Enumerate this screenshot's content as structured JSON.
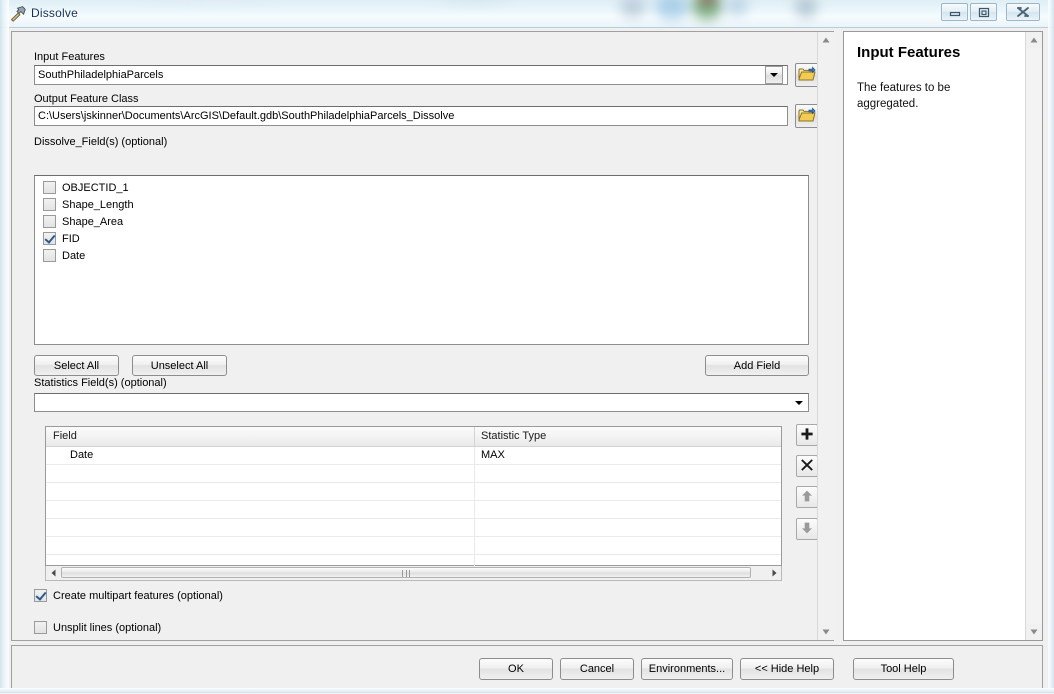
{
  "window": {
    "title": "Dissolve",
    "icon": "hammer-tool-icon",
    "controls": {
      "minimize": "minimize-icon",
      "maximize": "maximize-icon",
      "close": "close-icon"
    }
  },
  "form": {
    "input_features": {
      "label": "Input Features",
      "value": "SouthPhiladelphiaParcels",
      "browse_icon": "open-folder-icon",
      "dropdown_icon": "chevron-down-icon"
    },
    "output_feature_class": {
      "label": "Output Feature Class",
      "value": "C:\\Users\\jskinner\\Documents\\ArcGIS\\Default.gdb\\SouthPhiladelphiaParcels_Dissolve",
      "browse_icon": "open-folder-icon"
    },
    "dissolve_fields": {
      "label": "Dissolve_Field(s) (optional)",
      "items": [
        {
          "name": "OBJECTID_1",
          "checked": false
        },
        {
          "name": "Shape_Length",
          "checked": false
        },
        {
          "name": "Shape_Area",
          "checked": false
        },
        {
          "name": "FID",
          "checked": true
        },
        {
          "name": "Date",
          "checked": false
        }
      ]
    },
    "list_buttons": {
      "select_all": "Select All",
      "unselect_all": "Unselect All",
      "add_field": "Add Field"
    },
    "statistics_fields": {
      "label": "Statistics Field(s) (optional)",
      "value": "",
      "dropdown_icon": "chevron-down-icon"
    },
    "statistics_grid": {
      "columns": [
        "Field",
        "Statistic Type"
      ],
      "rows": [
        {
          "field": "Date",
          "statistic_type": "MAX"
        },
        {
          "field": "",
          "statistic_type": ""
        },
        {
          "field": "",
          "statistic_type": ""
        },
        {
          "field": "",
          "statistic_type": ""
        },
        {
          "field": "",
          "statistic_type": ""
        },
        {
          "field": "",
          "statistic_type": ""
        },
        {
          "field": "",
          "statistic_type": ""
        }
      ],
      "tools": {
        "add": "plus-icon",
        "remove": "x-icon",
        "move_up": "arrow-up-icon",
        "move_down": "arrow-down-icon"
      }
    },
    "options": [
      {
        "label": "Create multipart features (optional)",
        "checked": true
      },
      {
        "label": "Unsplit lines (optional)",
        "checked": false
      }
    ]
  },
  "help": {
    "title": "Input Features",
    "text": "The features to be aggregated."
  },
  "footer": {
    "ok": "OK",
    "cancel": "Cancel",
    "environments": "Environments...",
    "hide_help": "<< Hide Help",
    "tool_help": "Tool Help"
  },
  "colors": {
    "dialog_bg": "#f0f0f0",
    "field_bg": "#ffffff",
    "border": "#8e8e8e",
    "title_text": "#10335c",
    "check_accent": "#2c5a8c",
    "folder_icon": "#f2cc52"
  }
}
